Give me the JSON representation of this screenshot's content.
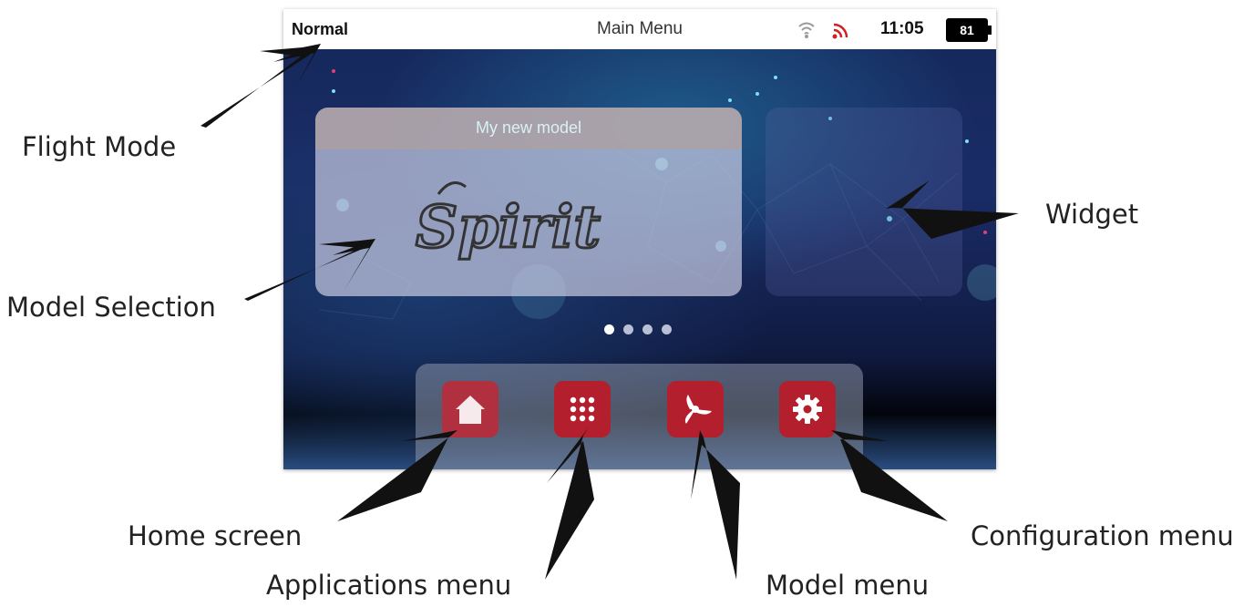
{
  "annotations": {
    "flight_mode": "Flight Mode",
    "model_selection": "Model Selection",
    "widget": "Widget",
    "home_screen": "Home screen",
    "applications_menu": "Applications menu",
    "model_menu": "Model menu",
    "configuration_menu": "Configuration menu"
  },
  "status_bar": {
    "flight_mode": "Normal",
    "title": "Main Menu",
    "time": "11:05",
    "battery": "81",
    "icons": [
      "wifi-icon",
      "rss-signal-icon"
    ],
    "rss_color": "#d22020"
  },
  "model": {
    "name": "My new model",
    "logo_text": "Spirit"
  },
  "pagination": {
    "total": 4,
    "active": 1
  },
  "dock": {
    "buttons": [
      "home-icon",
      "apps-grid-icon",
      "propeller-icon",
      "gear-icon"
    ],
    "button_color": "#b31f2c"
  }
}
